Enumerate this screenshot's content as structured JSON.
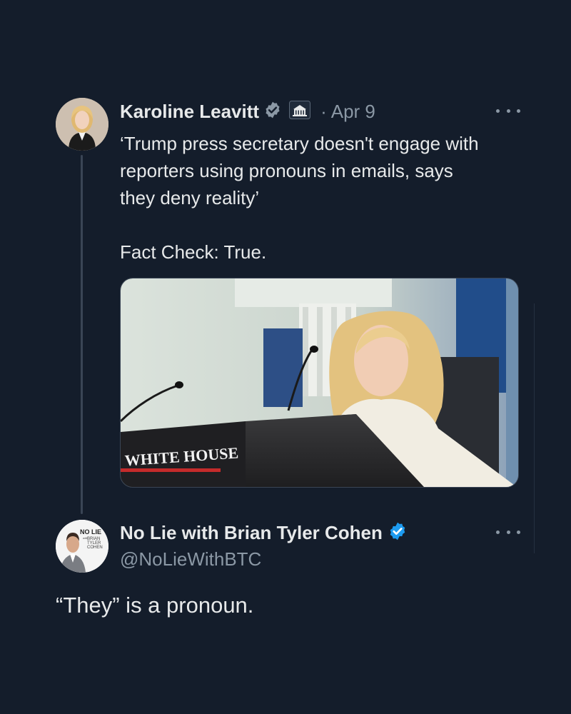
{
  "original_tweet": {
    "author_name": "Karoline Leavitt",
    "date": "Apr 9",
    "separator": "·",
    "text_lines": [
      "‘Trump press secretary doesn't engage with",
      "reporters using pronouns in emails, says",
      "they deny reality’"
    ],
    "fact_check": "Fact Check: True.",
    "media": {
      "podium_sign": "WHITE HOUSE"
    }
  },
  "reply_tweet": {
    "author_name": "No Lie with Brian Tyler Cohen",
    "handle": "@NoLieWithBTC",
    "text": "“They” is a pronoun.",
    "avatar_logo_lines": [
      "NO LIE",
      "with",
      "BRIAN",
      "TYLER",
      "COHEN"
    ]
  },
  "colors": {
    "background": "#141d2b",
    "text": "#e7e9ea",
    "secondary_text": "#8b98a5",
    "verified_gray": "#8b98a5",
    "verified_blue": "#1d9bf0"
  },
  "icons": {
    "verified_gray": "verified-badge-gray",
    "verified_blue": "verified-badge-blue",
    "affiliation": "white-house-icon",
    "more": "more-options-dots"
  }
}
